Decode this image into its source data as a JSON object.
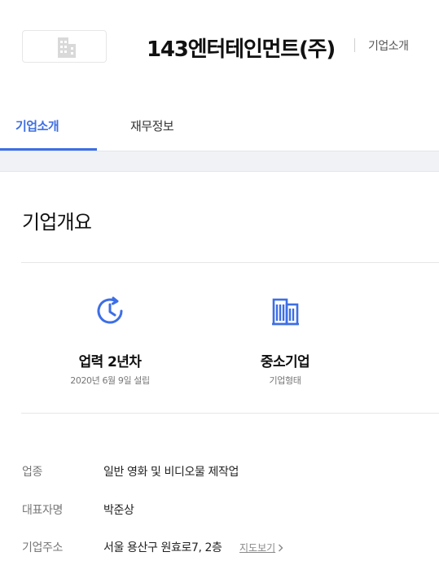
{
  "header": {
    "company_name": "143엔터테인먼트(주)",
    "sub_label": "기업소개"
  },
  "tabs": [
    {
      "label": "기업소개",
      "active": true
    },
    {
      "label": "재무정보",
      "active": false
    }
  ],
  "overview": {
    "title": "기업개요",
    "stats": [
      {
        "icon": "clock-icon",
        "main": "업력 2년차",
        "sub": "2020년 6월 9일 설립"
      },
      {
        "icon": "building-icon",
        "main": "중소기업",
        "sub": "기업형태"
      }
    ]
  },
  "info": [
    {
      "label": "업종",
      "value": "일반 영화 및 비디오물 제작업"
    },
    {
      "label": "대표자명",
      "value": "박준상"
    },
    {
      "label": "기업주소",
      "value": "서울 용산구 원효로7, 2층"
    }
  ],
  "map_link": {
    "label": "지도보기"
  },
  "colors": {
    "accent": "#3d6ee5",
    "band": "#f0f2f6"
  }
}
